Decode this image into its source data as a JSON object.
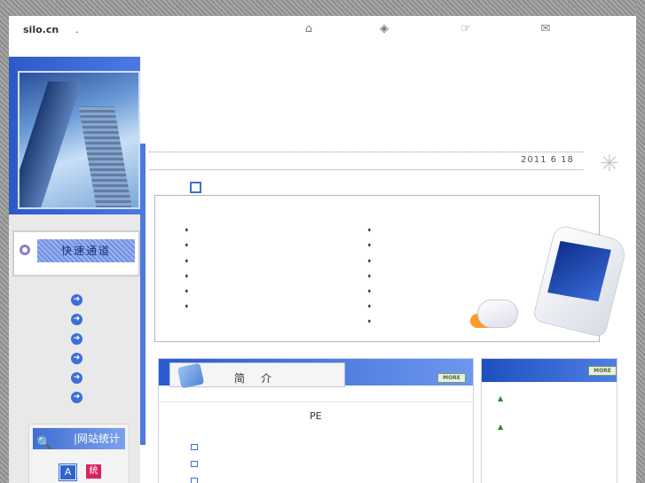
{
  "header": {
    "logo": "silo.cn",
    "logo_suffix": ".",
    "icons": [
      "home-icon",
      "tag-icon",
      "pointer-hand-icon",
      "mail-icon"
    ]
  },
  "sidebar": {
    "quick_access_label": "快速通道",
    "nav_items_count": 6,
    "stats_label": "网站统计",
    "stats_prefix": "|",
    "stats_icons": {
      "a": "A",
      "b": "统"
    }
  },
  "main": {
    "date": "2011 6 18",
    "intro_title": "简介",
    "intro_more": "MORE",
    "right_more": "MORE",
    "intro_text": "PE"
  }
}
